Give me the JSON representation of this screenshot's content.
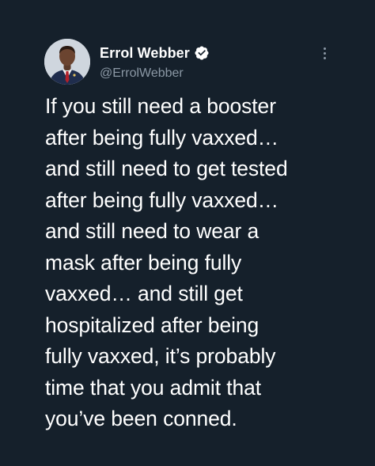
{
  "author": {
    "display_name": "Errol Webber",
    "handle": "@ErrolWebber",
    "verified": true,
    "avatar_icon": "profile-photo"
  },
  "menu": {
    "icon": "more-vertical-icon"
  },
  "tweet": {
    "lines": [
      "If you still need a booster",
      "after being fully vaxxed…",
      "and still need to get tested",
      "after being fully vaxxed…",
      "and still need to wear a",
      "mask after being fully",
      "vaxxed… and still get",
      "hospitalized after being",
      "fully vaxxed, it’s probably",
      "time that you admit that",
      "you’ve been conned."
    ]
  },
  "colors": {
    "background": "#15202b",
    "text": "#ffffff",
    "secondary_text": "#8b98a5",
    "verified_badge": "#ffffff"
  }
}
